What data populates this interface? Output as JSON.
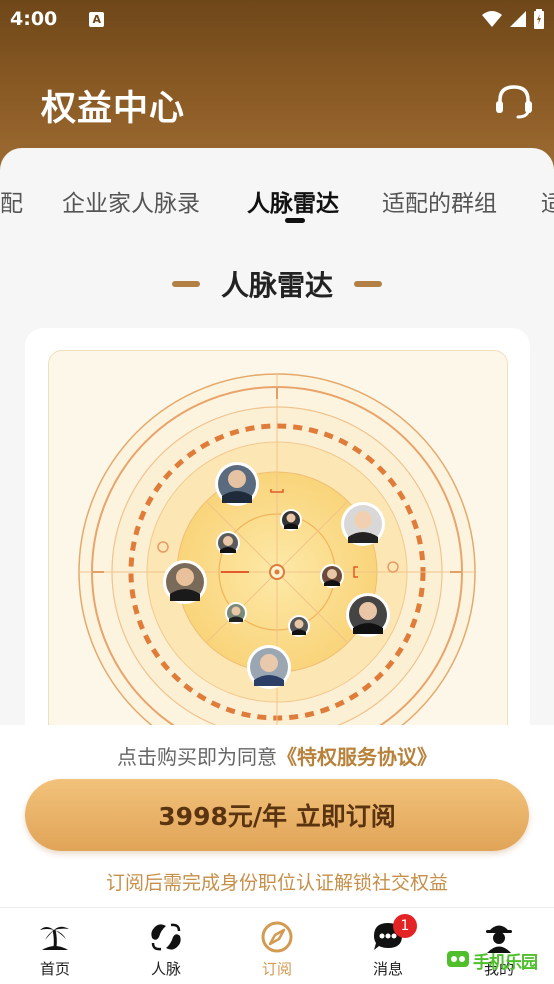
{
  "status_bar": {
    "time": "4:00",
    "notification_icon": "A"
  },
  "header": {
    "title": "权益中心",
    "support_icon": "headset-icon"
  },
  "tabs": [
    {
      "label": "配",
      "active": false
    },
    {
      "label": "企业家人脉录",
      "active": false
    },
    {
      "label": "人脉雷达",
      "active": true
    },
    {
      "label": "适配的群组",
      "active": false
    },
    {
      "label": "适",
      "active": false
    }
  ],
  "section": {
    "title": "人脉雷达"
  },
  "purchase": {
    "agree_prefix": "点击购买即为同意",
    "agree_link": "《特权服务协议》",
    "button_label": "3998元/年 立即订阅",
    "hint": "订阅后需完成身份职位认证解锁社交权益"
  },
  "bottom_nav": [
    {
      "label": "首页",
      "icon": "island-icon"
    },
    {
      "label": "人脉",
      "icon": "connection-icon"
    },
    {
      "label": "订阅",
      "icon": "compass-icon",
      "active": true
    },
    {
      "label": "消息",
      "icon": "message-icon",
      "badge": "1"
    },
    {
      "label": "我的",
      "icon": "profile-icon"
    }
  ],
  "watermark": {
    "text": "手机乐园"
  },
  "colors": {
    "brand_brown": "#8a5a24",
    "accent_gold": "#d39a52",
    "badge_red": "#e42424"
  }
}
